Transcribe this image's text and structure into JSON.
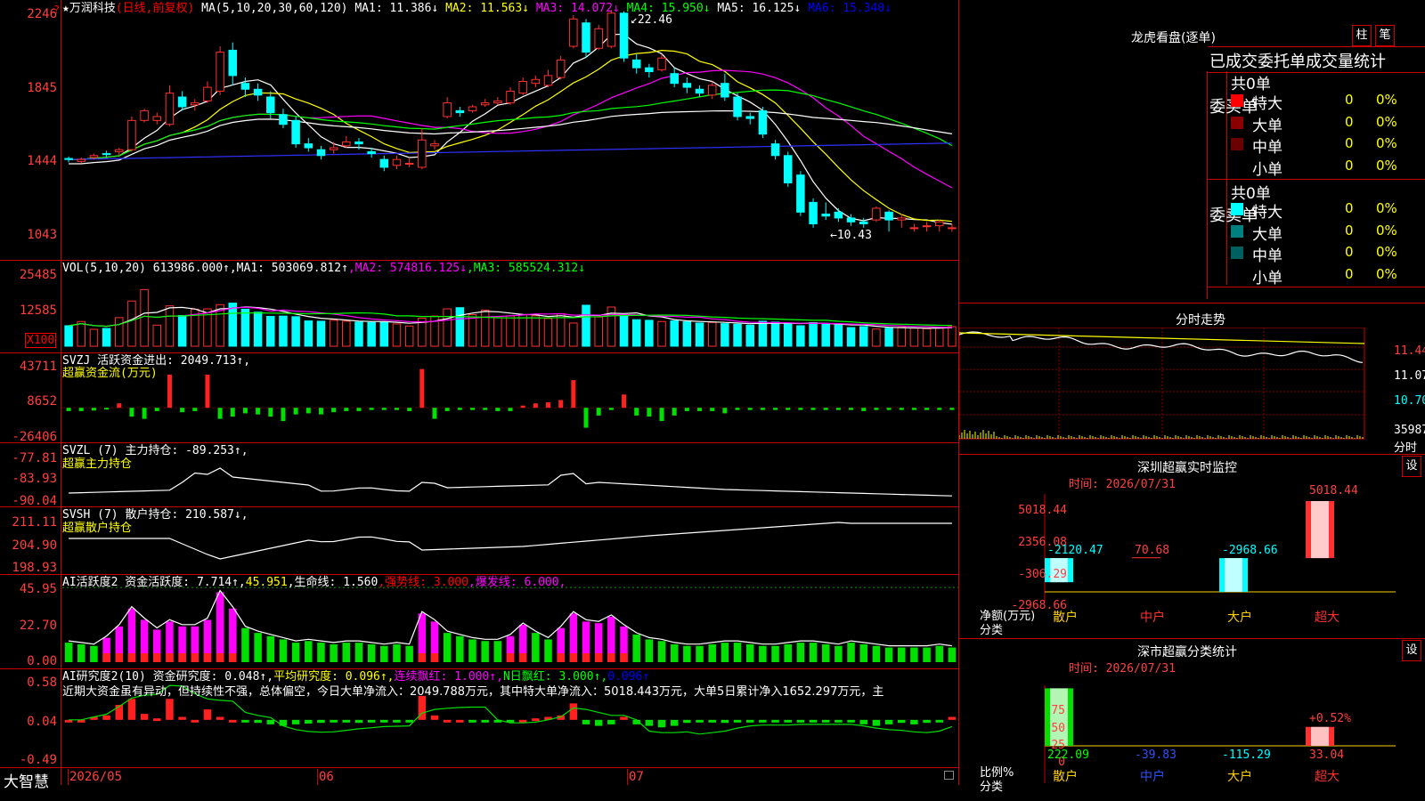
{
  "app": {
    "logo": "大智慧"
  },
  "main_header": {
    "stock": "★万润科技",
    "mode": "(日线,前复权)",
    "ma_label": "MA(5,10,20,30,60,120)",
    "ma1": "MA1: 11.386↓",
    "ma2": "MA2: 11.563↓",
    "ma3": "MA3: 14.072↓",
    "ma4": "MA4: 15.950↓",
    "ma5": "MA5: 16.125↓",
    "ma6": "MA6: 15.340↓",
    "high_mark": "22.46",
    "low_mark": "←10.43"
  },
  "vol_header": {
    "label": "VOL(5,10,20)",
    "value": "613986.000↑",
    "ma1": ",MA1: 503069.812↑",
    "ma2": ",MA2: 574816.125↓",
    "ma3": ",MA3: 585524.312↓",
    "unit": "X100"
  },
  "svzj_header": {
    "label": "SVZJ  活跃资金进出: 2049.713↑,",
    "sub": "超赢资金流(万元)"
  },
  "svzl_header": {
    "label": "SVZL (7) 主力持仓: -89.253↑,",
    "sub": "超赢主力持仓"
  },
  "svsh_header": {
    "label": "SVSH (7) 散户持仓: 210.587↓,",
    "sub": "超赢散户持仓"
  },
  "ai_header": {
    "label": "AI活跃度2 资金活跃度: 7.714↑,",
    "v2": "45.951",
    "life": ",生命线: 1.560",
    "strong": ",强势线: 3.000",
    "burst": ",爆发线: 6.000,"
  },
  "research_header": {
    "label": "AI研究度2(10) 资金研究度: 0.048↑,",
    "avg": "平均研究度: 0.096↑,",
    "red": "连续飘红: 1.000↑,",
    "nred": "N日飘红: 3.000↑,",
    "blue": "0.096↑",
    "comment": "近期大资金虽有异动，但持续性不强，总体偏空，今日大单净流入：2049.788万元，其中特大单净流入：5018.443万元，大单5日累计净入1652.297万元，主"
  },
  "axes": {
    "price": [
      "2246",
      "1845",
      "1444",
      "1043"
    ],
    "vol": [
      "25485",
      "12585"
    ],
    "svzj": [
      "43711",
      "8652",
      "-26406"
    ],
    "svzl": [
      "-77.81",
      "-83.93",
      "-90.04"
    ],
    "svsh": [
      "211.11",
      "204.90",
      "198.93"
    ],
    "ai": [
      "45.95",
      "22.70",
      "0.00"
    ],
    "research": [
      "0.58",
      "0.04",
      "-0.49"
    ],
    "dates": [
      "2026/05",
      "06",
      "07"
    ]
  },
  "right": {
    "dragon_title": "龙虎看盘(逐单)",
    "btn_bar": "柱",
    "btn_pen": "笔",
    "tabs": [
      "已成交",
      "委托单",
      "成交量",
      "统计"
    ],
    "buy_label": "委买单",
    "sell_label": "委卖单",
    "buy_total": "共0单",
    "sell_total": "共0单",
    "rows": [
      "特大",
      "大单",
      "中单",
      "小单"
    ],
    "zero": "0",
    "pct": "0%",
    "buy_colors": [
      "#ff0000",
      "#8a0000",
      "#6a0000",
      "#000000"
    ],
    "sell_colors": [
      "#00ffff",
      "#008080",
      "#006060",
      "#000000"
    ],
    "fenshi_title": "分时走势",
    "fenshi_axis": [
      "11.44",
      "11.07",
      "10.70"
    ],
    "fenshi_vol": "35987",
    "fenshi_unit": "分时",
    "monitor_title": "深圳超赢实时监控",
    "btn_set": "设",
    "time_label": "时间: 2026/07/31",
    "monitor_axis": [
      "5018.44",
      "2356.08",
      "-306.29",
      "-2968.66"
    ],
    "monitor_values": [
      "-2120.47",
      "70.68",
      "-2968.66",
      "5018.44"
    ],
    "monitor_ylabel": "净额(万元)",
    "monitor_xlabel": "分类",
    "cats": [
      "散户",
      "中户",
      "大户",
      "超大"
    ],
    "class_title": "深市超赢分类统计",
    "class_axis": [
      "75",
      "50",
      "25",
      "0"
    ],
    "class_values": [
      "222.09",
      "-39.83",
      "-115.29",
      "33.04"
    ],
    "class_pct": "+0.52%",
    "class_ylabel": "比例%",
    "class_xlabel": "分类"
  },
  "chart_data": {
    "type": "candlestick",
    "price_range": [
      10.43,
      22.46
    ],
    "candles": [
      [
        14.85,
        14.8,
        14.95,
        14.65
      ],
      [
        14.7,
        14.8,
        14.9,
        14.6
      ],
      [
        14.9,
        15.0,
        15.1,
        14.8
      ],
      [
        15.1,
        15.05,
        15.25,
        14.9
      ],
      [
        15.2,
        15.3,
        15.4,
        15.0
      ],
      [
        15.3,
        16.8,
        17.0,
        15.2
      ],
      [
        16.8,
        17.3,
        17.4,
        16.7
      ],
      [
        16.8,
        17.0,
        17.2,
        16.6
      ],
      [
        16.6,
        18.2,
        18.6,
        16.5
      ],
      [
        18.0,
        17.5,
        18.3,
        17.3
      ],
      [
        17.6,
        17.7,
        17.9,
        17.3
      ],
      [
        17.8,
        18.5,
        18.8,
        17.7
      ],
      [
        18.3,
        20.3,
        20.6,
        18.1
      ],
      [
        20.4,
        19.1,
        20.8,
        18.6
      ],
      [
        18.7,
        18.4,
        19.0,
        18.0
      ],
      [
        18.4,
        18.1,
        18.7,
        17.8
      ],
      [
        18.0,
        17.2,
        18.3,
        16.9
      ],
      [
        17.1,
        16.6,
        17.4,
        16.4
      ],
      [
        16.8,
        15.6,
        17.0,
        15.4
      ],
      [
        15.6,
        15.4,
        15.9,
        15.2
      ],
      [
        15.3,
        15.0,
        15.5,
        14.8
      ],
      [
        15.3,
        15.4,
        15.7,
        15.1
      ],
      [
        15.5,
        15.7,
        16.0,
        15.4
      ],
      [
        15.7,
        15.6,
        15.9,
        15.3
      ],
      [
        15.2,
        15.1,
        15.4,
        14.9
      ],
      [
        14.8,
        14.4,
        15.0,
        14.2
      ],
      [
        14.5,
        14.8,
        15.0,
        14.3
      ],
      [
        14.6,
        14.6,
        14.9,
        14.4
      ],
      [
        14.4,
        15.8,
        16.4,
        14.3
      ],
      [
        15.5,
        15.6,
        15.8,
        15.3
      ],
      [
        17.0,
        17.7,
        18.0,
        16.9
      ],
      [
        17.3,
        17.2,
        17.5,
        17.0
      ],
      [
        17.3,
        17.5,
        17.6,
        17.2
      ],
      [
        17.6,
        17.7,
        17.9,
        17.5
      ],
      [
        17.7,
        17.8,
        18.0,
        17.6
      ],
      [
        17.7,
        18.3,
        18.5,
        17.6
      ],
      [
        18.2,
        18.8,
        19.0,
        18.1
      ],
      [
        18.7,
        18.9,
        19.1,
        18.5
      ],
      [
        18.6,
        19.1,
        19.4,
        18.5
      ],
      [
        19.0,
        19.9,
        20.1,
        18.9
      ],
      [
        20.6,
        22.0,
        22.2,
        20.5
      ],
      [
        21.8,
        20.3,
        22.0,
        20.0
      ],
      [
        20.5,
        21.5,
        21.7,
        20.4
      ],
      [
        20.6,
        22.3,
        22.46,
        20.5
      ],
      [
        22.3,
        20.0,
        22.4,
        19.8
      ],
      [
        19.9,
        19.5,
        20.2,
        19.2
      ],
      [
        19.5,
        19.3,
        19.7,
        19.0
      ],
      [
        19.4,
        20.0,
        20.2,
        19.3
      ],
      [
        19.2,
        18.7,
        19.5,
        18.5
      ],
      [
        18.7,
        18.5,
        19.0,
        18.2
      ],
      [
        18.4,
        18.2,
        18.6,
        18.0
      ],
      [
        18.1,
        18.6,
        18.8,
        17.9
      ],
      [
        18.7,
        18.0,
        19.2,
        17.8
      ],
      [
        18.0,
        17.0,
        18.2,
        16.8
      ],
      [
        17.0,
        16.9,
        17.2,
        16.6
      ],
      [
        17.3,
        16.1,
        17.5,
        15.9
      ],
      [
        15.6,
        15.0,
        15.8,
        14.8
      ],
      [
        15.0,
        13.6,
        15.2,
        13.4
      ],
      [
        14.0,
        12.1,
        14.2,
        11.9
      ],
      [
        12.6,
        11.5,
        12.8,
        11.3
      ],
      [
        12.0,
        11.9,
        12.6,
        11.7
      ],
      [
        12.1,
        11.8,
        12.3,
        11.6
      ],
      [
        11.8,
        11.6,
        12.0,
        11.4
      ],
      [
        11.6,
        11.5,
        11.8,
        11.3
      ],
      [
        11.7,
        12.3,
        12.4,
        11.6
      ],
      [
        12.1,
        11.7,
        12.2,
        11.1
      ],
      [
        11.7,
        11.8,
        12.0,
        11.3
      ],
      [
        11.3,
        11.3,
        11.5,
        11.1
      ],
      [
        11.4,
        11.4,
        11.6,
        11.1
      ],
      [
        11.4,
        11.6,
        11.7,
        11.1
      ],
      [
        11.3,
        11.3,
        11.5,
        11.1
      ]
    ],
    "volume": [
      6800,
      8200,
      5600,
      5900,
      9500,
      15000,
      18800,
      7000,
      13400,
      10200,
      12300,
      12400,
      13800,
      14300,
      12300,
      11300,
      9900,
      10000,
      9800,
      8400,
      8300,
      8600,
      8300,
      8000,
      7900,
      8100,
      7400,
      6700,
      9300,
      10000,
      12400,
      12800,
      10500,
      12000,
      9500,
      10100,
      10500,
      10100,
      9200,
      10800,
      7700,
      13600,
      9700,
      13000,
      10200,
      8800,
      8600,
      8200,
      8400,
      8100,
      7700,
      7900,
      7500,
      7300,
      7000,
      8300,
      8000,
      7500,
      6800,
      7800,
      7600,
      7100,
      6200,
      6500,
      5700,
      6000,
      6300,
      6000,
      5800,
      6000,
      6500
    ],
    "svzj_bars": [
      -3000,
      -3000,
      -2500,
      -1500,
      4000,
      -8000,
      -10000,
      -3000,
      30000,
      -4000,
      -3000,
      30000,
      -10000,
      -8000,
      -5000,
      -6000,
      -8000,
      -12000,
      -6000,
      -5000,
      -6000,
      -4000,
      -3000,
      -3000,
      -2000,
      -2000,
      -2000,
      -3000,
      35000,
      -10000,
      -3000,
      -2000,
      -2000,
      -2000,
      -3000,
      -3000,
      2000,
      4000,
      5000,
      7000,
      25000,
      -18000,
      -7000,
      -2000,
      12000,
      -7000,
      -8000,
      -12000,
      -7000,
      -3000,
      -3000,
      -3000,
      -5000,
      -2000,
      -2000,
      -2000,
      -2000,
      -2000,
      -2000,
      -2000,
      -2000,
      -2000,
      -2000,
      -3000,
      -2000,
      -2000,
      -2000,
      -2000,
      -2000,
      -2000,
      -2000
    ],
    "ai_bars": [
      12,
      11,
      10,
      15,
      22,
      33,
      26,
      20,
      25,
      22,
      22,
      26,
      43,
      33,
      21,
      18,
      16,
      14,
      12,
      13,
      12,
      11,
      12,
      12,
      11,
      10,
      11,
      10,
      30,
      25,
      18,
      16,
      14,
      13,
      13,
      16,
      23,
      18,
      14,
      21,
      30,
      25,
      24,
      28,
      22,
      17,
      14,
      13,
      11,
      10,
      10,
      11,
      12,
      12,
      11,
      10,
      10,
      11,
      12,
      12,
      11,
      10,
      12,
      11,
      10,
      9,
      9,
      9,
      9,
      10,
      9
    ],
    "ai_bar_kinds": [
      "g",
      "g",
      "g",
      "m",
      "m",
      "m",
      "m",
      "m",
      "m",
      "m",
      "m",
      "m",
      "m",
      "m",
      "g",
      "g",
      "g",
      "g",
      "g",
      "g",
      "g",
      "g",
      "g",
      "g",
      "g",
      "g",
      "g",
      "g",
      "m",
      "m",
      "g",
      "g",
      "g",
      "g",
      "g",
      "m",
      "m",
      "g",
      "g",
      "m",
      "m",
      "m",
      "m",
      "m",
      "m",
      "g",
      "g",
      "g",
      "g",
      "g",
      "g",
      "g",
      "g",
      "g",
      "g",
      "g",
      "g",
      "g",
      "g",
      "g",
      "g",
      "g",
      "g",
      "g",
      "g",
      "g",
      "g",
      "g",
      "g",
      "g",
      "g"
    ],
    "research_bars": [
      0.0,
      0.0,
      0.04,
      0.06,
      0.2,
      0.28,
      0.08,
      0.02,
      0.28,
      0.04,
      0.0,
      0.14,
      0.04,
      0.0,
      -0.02,
      -0.04,
      -0.06,
      -0.08,
      -0.06,
      -0.05,
      -0.04,
      -0.03,
      -0.02,
      -0.04,
      -0.03,
      -0.02,
      -0.03,
      -0.02,
      0.32,
      0.06,
      0.0,
      0.0,
      -0.02,
      -0.02,
      -0.02,
      -0.02,
      0.0,
      0.02,
      0.04,
      0.06,
      0.22,
      -0.06,
      -0.08,
      -0.06,
      0.04,
      -0.06,
      -0.08,
      -0.1,
      -0.08,
      -0.04,
      -0.02,
      -0.02,
      -0.04,
      -0.02,
      -0.02,
      -0.02,
      -0.02,
      -0.02,
      -0.02,
      -0.02,
      -0.02,
      -0.02,
      -0.02,
      -0.06,
      -0.08,
      -0.06,
      -0.04,
      -0.06,
      -0.04,
      -0.02,
      0.04
    ]
  }
}
